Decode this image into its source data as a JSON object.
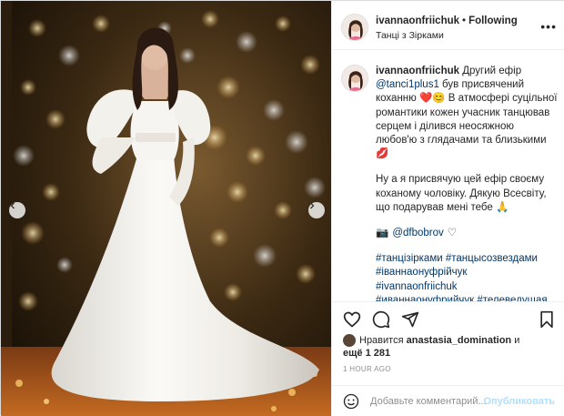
{
  "post": {
    "username": "ivannaonfriichuk",
    "separator": "•",
    "follow_label": "Following",
    "location": "Танці з Зірками",
    "more": "•••"
  },
  "caption": {
    "username": "ivannaonfriichuk",
    "p1_a": "Другий ефір ",
    "p1_mention": "@tanci1plus1",
    "p1_b": " був присвячений коханню ",
    "p1_emoji": "❤️😊",
    "p1_c": " В атмосфері суцільної романтики кожен учасник танцював серцем і ділився неосяжною любов'ю з глядачами та близькими ",
    "p1_emoji2": "💋",
    "p2": "Ну а я присвячую цей ефір своєму коханому чоловіку. Дякую Всесвіту, що подарував мені тебе 🙏",
    "photo_credit_icon": "📷",
    "photo_credit": "@dfbobrov",
    "photo_credit_heart": "♡",
    "hashtags": [
      "#танцізірками #танцысозвездами",
      "#іваннаонуфрійчук",
      "#ivannaonfriichuk",
      "#иваннаонуфрийчук #телеведущая"
    ]
  },
  "likes": {
    "prefix": "Нравится",
    "liker": "anastasia_domination",
    "middle": "и",
    "count_text": "ещё 1 281"
  },
  "time": "1 HOUR AGO",
  "comment": {
    "placeholder": "Добавьте комментарий...",
    "post_label": "Опубликовать"
  },
  "colors": {
    "link": "#00376b",
    "border": "#dbdbdb",
    "muted": "#8e8e8e",
    "post_disabled": "#b2dffc"
  },
  "icons": [
    "chevron-left-icon",
    "chevron-right-icon",
    "heart-icon",
    "comment-icon",
    "share-icon",
    "bookmark-icon",
    "emoji-icon"
  ]
}
